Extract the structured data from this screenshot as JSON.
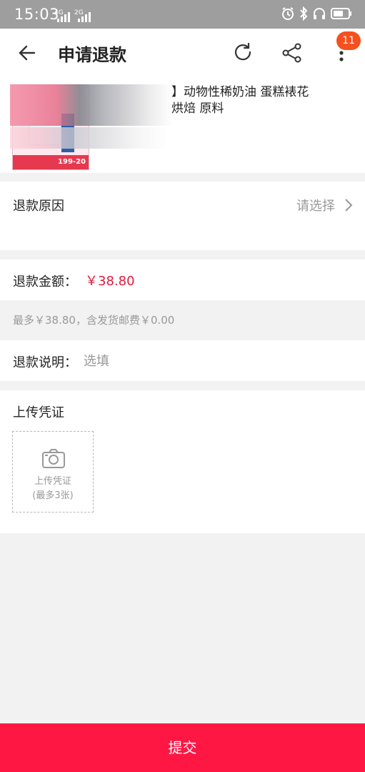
{
  "status_bar": {
    "time": "15:03",
    "signal1": "4G",
    "signal2": "2G"
  },
  "header": {
    "title": "申请退款",
    "badge_count": "11",
    "icons": [
      "back-arrow-icon",
      "refresh-icon",
      "share-icon",
      "more-vertical-icon"
    ]
  },
  "product": {
    "title_visible": "】动物性稀奶油 蛋糕裱花\n烘焙 原料",
    "thumb_price": "199-20"
  },
  "reason": {
    "label": "退款原因",
    "value": "请选择"
  },
  "amount": {
    "label": "退款金额：",
    "value": "￥38.80"
  },
  "hint": "最多￥38.80，含发货邮费￥0.00",
  "description": {
    "label": "退款说明：",
    "placeholder": "选填"
  },
  "upload": {
    "label": "上传凭证",
    "box_line1": "上传凭证",
    "box_line2": "(最多3张)"
  },
  "submit_label": "提交",
  "colors": {
    "accent_red": "#ff1744",
    "price_red": "#e4193b",
    "badge_orange": "#f5501e"
  }
}
